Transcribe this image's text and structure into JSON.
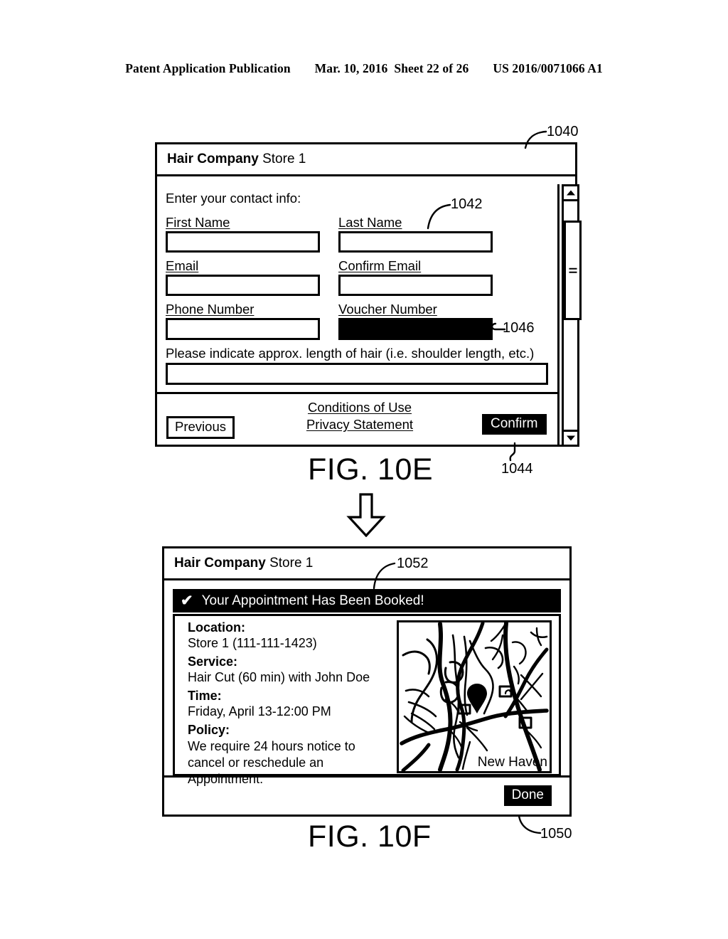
{
  "page_header": {
    "publication": "Patent Application Publication",
    "date": "Mar. 10, 2016",
    "sheet": "Sheet 22 of 26",
    "patent_number": "US 2016/0071066 A1"
  },
  "fig10e": {
    "caption": "FIG. 10E",
    "ref_panel": "1040",
    "ref_form": "1042",
    "ref_confirm": "1044",
    "ref_voucher": "1046",
    "title_brand": "Hair Company",
    "title_store": "Store 1",
    "intro": "Enter your contact info:",
    "fields": [
      {
        "label": "First Name",
        "value": "",
        "filled": false
      },
      {
        "label": "Last Name",
        "value": "",
        "filled": false
      },
      {
        "label": "Email",
        "value": "",
        "filled": false
      },
      {
        "label": "Confirm Email",
        "value": "",
        "filled": false
      },
      {
        "label": "Phone Number",
        "value": "",
        "filled": false
      },
      {
        "label": "Voucher Number",
        "value": "",
        "filled": true
      }
    ],
    "hair_length_question": "Please indicate approx. length of hair (i.e. shoulder length, etc.)",
    "hair_length_value": "",
    "previous_label": "Previous",
    "confirm_label": "Confirm",
    "links": [
      "Conditions of Use",
      "Privacy Statement"
    ],
    "scrollbar": {
      "up_icon": "triangle-up-icon",
      "down_icon": "triangle-down-icon",
      "thumb_grip_icon": "grip-lines-icon"
    }
  },
  "fig10f": {
    "caption": "FIG. 10F",
    "ref_panel": "1050",
    "ref_banner": "1052",
    "title_brand": "Hair Company",
    "title_store": "Store 1",
    "banner_check": "✔",
    "banner_text": "Your Appointment Has Been Booked!",
    "details": [
      {
        "label": "Location:",
        "value": "Store 1 (111-111-1423)",
        "multiline": false
      },
      {
        "label": "Service:",
        "value": "Hair Cut (60 min) with John Doe",
        "multiline": false
      },
      {
        "label": "Time:",
        "value": "Friday, April 13-12:00 PM",
        "multiline": false
      },
      {
        "label": "Policy:",
        "value": "We require 24 hours notice to cancel or reschedule an Appointment.",
        "multiline": true
      }
    ],
    "map": {
      "city_label": "New Haven",
      "marker_icon": "map-pin-icon"
    },
    "done_label": "Done"
  },
  "transition_arrow_icon": "arrow-down-icon",
  "colors": {
    "ink": "#000000",
    "paper": "#ffffff"
  }
}
